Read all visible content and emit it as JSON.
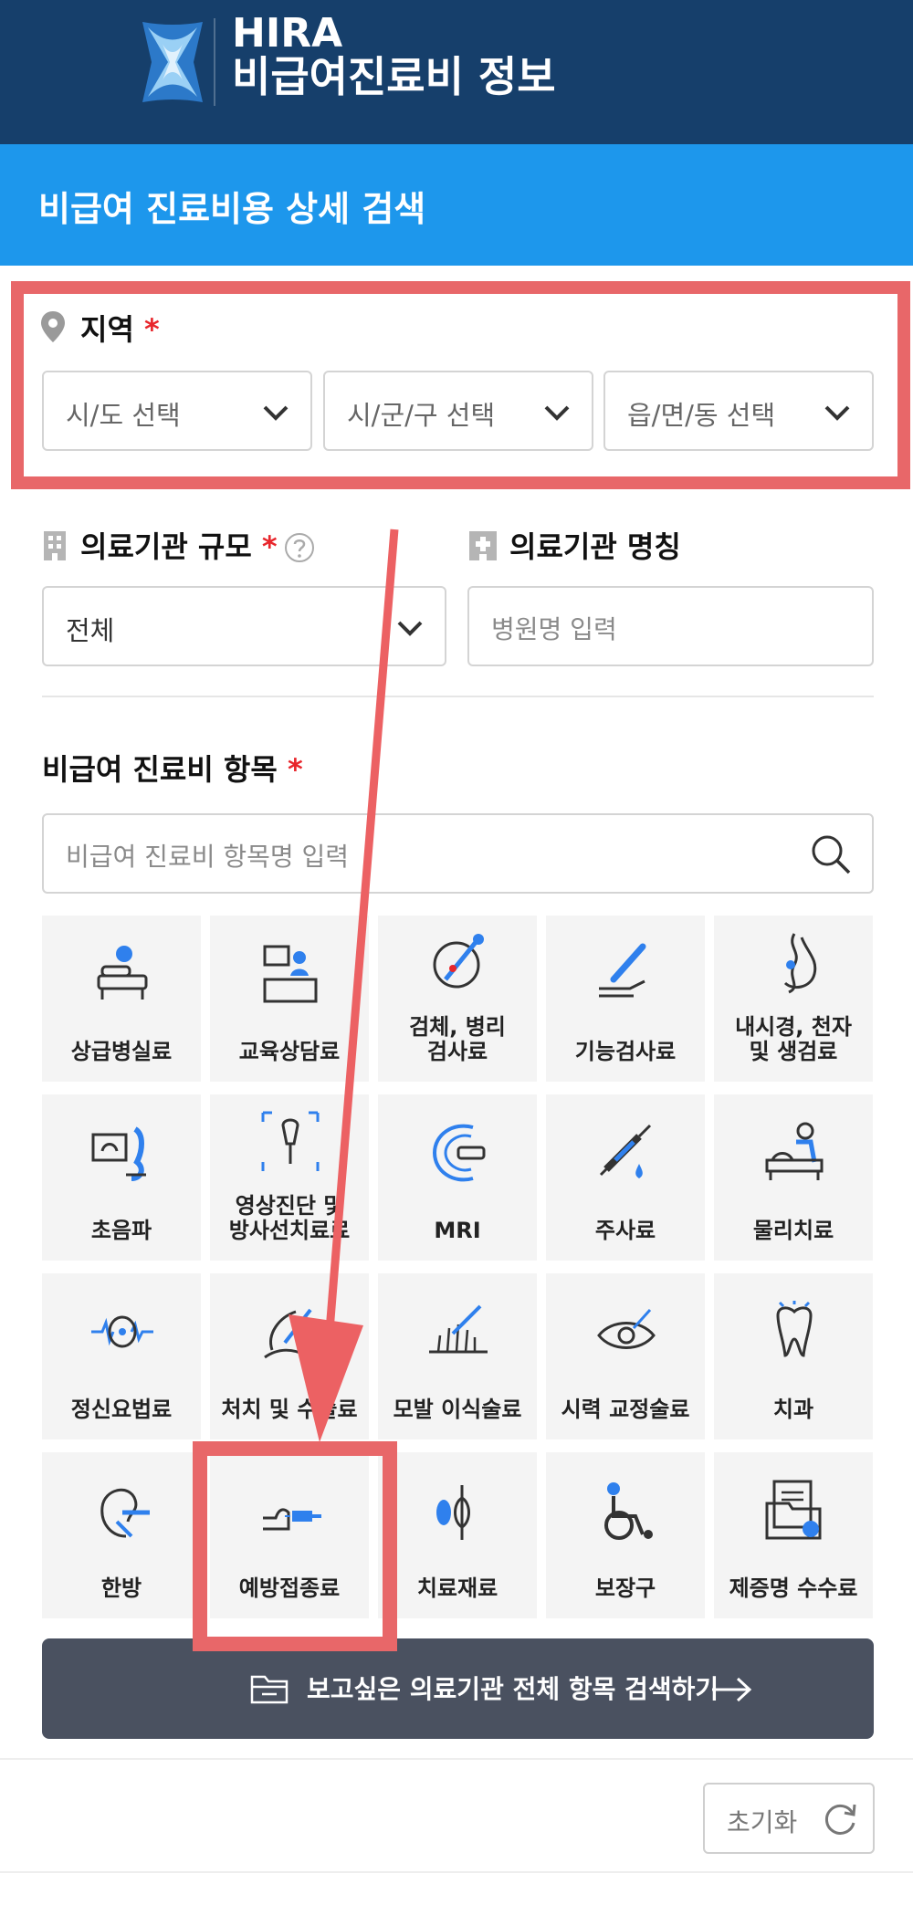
{
  "header": {
    "brand": "HIRA",
    "title": "비급여진료비 정보"
  },
  "subbar": {
    "title": "비급여 진료비용 상세 검색"
  },
  "region": {
    "label": "지역",
    "required_mark": "*",
    "selects": [
      "시/도 선택",
      "시/군/구 선택",
      "읍/면/동 선택"
    ]
  },
  "institution_size": {
    "label": "의료기관 규모",
    "required_mark": "*",
    "help_icon": "question-circle-icon",
    "value": "전체"
  },
  "institution_name": {
    "label": "의료기관 명칭",
    "placeholder": "병원명 입력"
  },
  "items": {
    "label": "비급여 진료비 항목",
    "required_mark": "*",
    "search_placeholder": "비급여 진료비 항목명 입력",
    "categories": [
      {
        "lines": [
          "상급병실료"
        ],
        "icon": "bed-icon"
      },
      {
        "lines": [
          "교육상담료"
        ],
        "icon": "counseling-icon"
      },
      {
        "lines": [
          "검체, 병리",
          "검사료"
        ],
        "icon": "lab-test-icon"
      },
      {
        "lines": [
          "기능검사료"
        ],
        "icon": "function-test-icon"
      },
      {
        "lines": [
          "내시경, 천자",
          "및 생검료"
        ],
        "icon": "endoscope-icon"
      },
      {
        "lines": [
          "초음파"
        ],
        "icon": "ultrasound-icon"
      },
      {
        "lines": [
          "영상진단 및",
          "방사선치료료"
        ],
        "icon": "imaging-icon"
      },
      {
        "lines": [
          "MRI"
        ],
        "icon": "mri-icon"
      },
      {
        "lines": [
          "주사료"
        ],
        "icon": "syringe-icon"
      },
      {
        "lines": [
          "물리치료"
        ],
        "icon": "physio-icon"
      },
      {
        "lines": [
          "정신요법료"
        ],
        "icon": "brain-wave-icon"
      },
      {
        "lines": [
          "처치 및 수술료"
        ],
        "icon": "surgery-icon"
      },
      {
        "lines": [
          "모발 이식술료"
        ],
        "icon": "hair-transplant-icon"
      },
      {
        "lines": [
          "시력 교정술료"
        ],
        "icon": "eye-laser-icon"
      },
      {
        "lines": [
          "치과"
        ],
        "icon": "tooth-icon"
      },
      {
        "lines": [
          "한방"
        ],
        "icon": "acupuncture-ear-icon"
      },
      {
        "lines": [
          "예방접종료"
        ],
        "icon": "vaccination-icon"
      },
      {
        "lines": [
          "치료재료"
        ],
        "icon": "material-icon"
      },
      {
        "lines": [
          "보장구"
        ],
        "icon": "wheelchair-icon"
      },
      {
        "lines": [
          "제증명 수수료"
        ],
        "icon": "certificate-icon"
      }
    ]
  },
  "search_all_button": {
    "label": "보고싶은 의료기관 전체 항목 검색하기"
  },
  "reset_button": {
    "label": "초기화"
  },
  "colors": {
    "header": "#163f6b",
    "accent": "#1d97ec",
    "highlight": "#e86769",
    "button_dark": "#4a5160"
  }
}
